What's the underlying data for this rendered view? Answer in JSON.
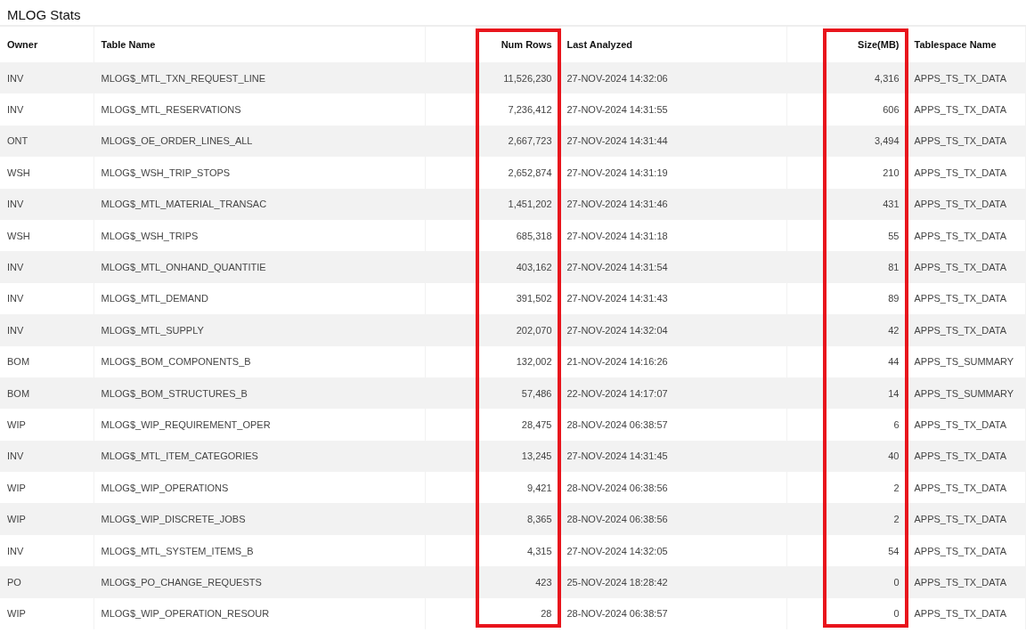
{
  "title": "MLOG Stats",
  "table": {
    "columns": [
      {
        "label": "Owner",
        "kind": "text",
        "highlighted": false
      },
      {
        "label": "Table Name",
        "kind": "text",
        "highlighted": false
      },
      {
        "label": "Num Rows",
        "kind": "number",
        "highlighted": true
      },
      {
        "label": "Last Analyzed",
        "kind": "text",
        "highlighted": false
      },
      {
        "label": "Size(MB)",
        "kind": "number",
        "highlighted": true
      },
      {
        "label": "Tablespace Name",
        "kind": "text",
        "highlighted": false
      }
    ],
    "rows": [
      [
        "INV",
        "MLOG$_MTL_TXN_REQUEST_LINE",
        "11,526,230",
        "27-NOV-2024 14:32:06",
        "4,316",
        "APPS_TS_TX_DATA"
      ],
      [
        "INV",
        "MLOG$_MTL_RESERVATIONS",
        "7,236,412",
        "27-NOV-2024 14:31:55",
        "606",
        "APPS_TS_TX_DATA"
      ],
      [
        "ONT",
        "MLOG$_OE_ORDER_LINES_ALL",
        "2,667,723",
        "27-NOV-2024 14:31:44",
        "3,494",
        "APPS_TS_TX_DATA"
      ],
      [
        "WSH",
        "MLOG$_WSH_TRIP_STOPS",
        "2,652,874",
        "27-NOV-2024 14:31:19",
        "210",
        "APPS_TS_TX_DATA"
      ],
      [
        "INV",
        "MLOG$_MTL_MATERIAL_TRANSAC",
        "1,451,202",
        "27-NOV-2024 14:31:46",
        "431",
        "APPS_TS_TX_DATA"
      ],
      [
        "WSH",
        "MLOG$_WSH_TRIPS",
        "685,318",
        "27-NOV-2024 14:31:18",
        "55",
        "APPS_TS_TX_DATA"
      ],
      [
        "INV",
        "MLOG$_MTL_ONHAND_QUANTITIE",
        "403,162",
        "27-NOV-2024 14:31:54",
        "81",
        "APPS_TS_TX_DATA"
      ],
      [
        "INV",
        "MLOG$_MTL_DEMAND",
        "391,502",
        "27-NOV-2024 14:31:43",
        "89",
        "APPS_TS_TX_DATA"
      ],
      [
        "INV",
        "MLOG$_MTL_SUPPLY",
        "202,070",
        "27-NOV-2024 14:32:04",
        "42",
        "APPS_TS_TX_DATA"
      ],
      [
        "BOM",
        "MLOG$_BOM_COMPONENTS_B",
        "132,002",
        "21-NOV-2024 14:16:26",
        "44",
        "APPS_TS_SUMMARY"
      ],
      [
        "BOM",
        "MLOG$_BOM_STRUCTURES_B",
        "57,486",
        "22-NOV-2024 14:17:07",
        "14",
        "APPS_TS_SUMMARY"
      ],
      [
        "WIP",
        "MLOG$_WIP_REQUIREMENT_OPER",
        "28,475",
        "28-NOV-2024 06:38:57",
        "6",
        "APPS_TS_TX_DATA"
      ],
      [
        "INV",
        "MLOG$_MTL_ITEM_CATEGORIES",
        "13,245",
        "27-NOV-2024 14:31:45",
        "40",
        "APPS_TS_TX_DATA"
      ],
      [
        "WIP",
        "MLOG$_WIP_OPERATIONS",
        "9,421",
        "28-NOV-2024 06:38:56",
        "2",
        "APPS_TS_TX_DATA"
      ],
      [
        "WIP",
        "MLOG$_WIP_DISCRETE_JOBS",
        "8,365",
        "28-NOV-2024 06:38:56",
        "2",
        "APPS_TS_TX_DATA"
      ],
      [
        "INV",
        "MLOG$_MTL_SYSTEM_ITEMS_B",
        "4,315",
        "27-NOV-2024 14:32:05",
        "54",
        "APPS_TS_TX_DATA"
      ],
      [
        "PO",
        "MLOG$_PO_CHANGE_REQUESTS",
        "423",
        "25-NOV-2024 18:28:42",
        "0",
        "APPS_TS_TX_DATA"
      ],
      [
        "WIP",
        "MLOG$_WIP_OPERATION_RESOUR",
        "28",
        "28-NOV-2024 06:38:57",
        "0",
        "APPS_TS_TX_DATA"
      ]
    ]
  }
}
